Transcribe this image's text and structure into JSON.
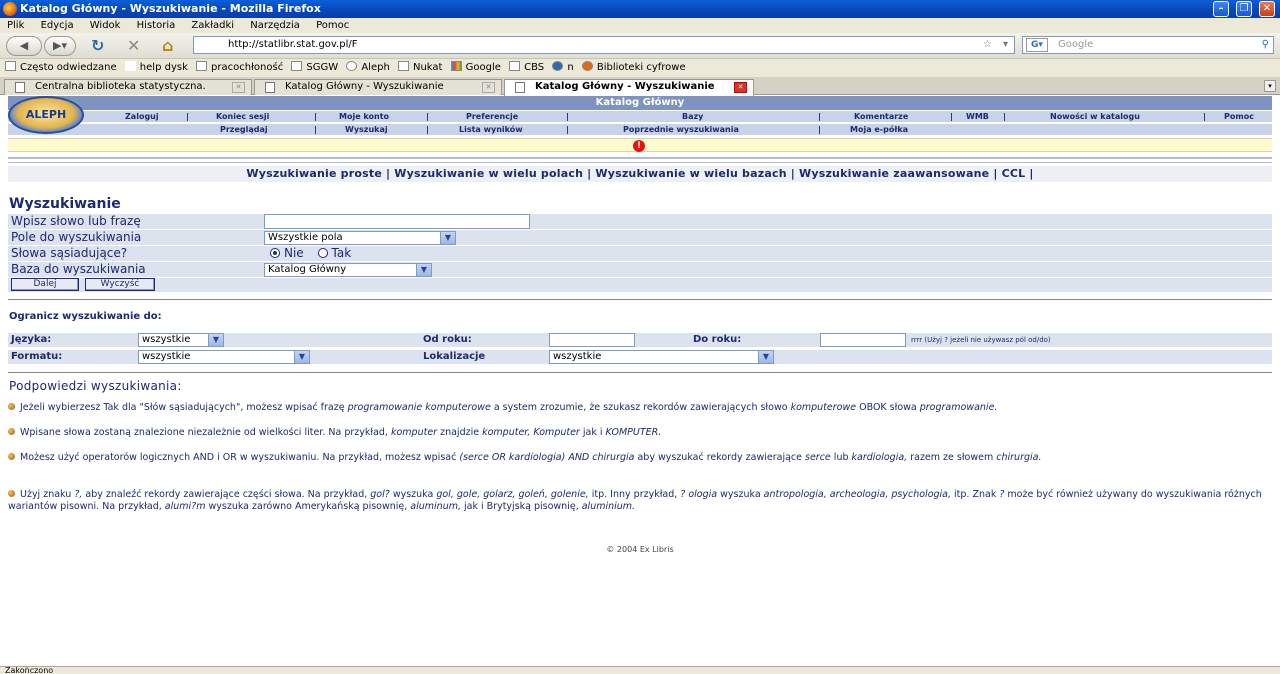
{
  "window": {
    "title": "Katalog Główny - Wyszukiwanie - Mozilla Firefox"
  },
  "menu": [
    "Plik",
    "Edycja",
    "Widok",
    "Historia",
    "Zakładki",
    "Narzędzia",
    "Pomoc"
  ],
  "address": {
    "url": "http://statlibr.stat.gov.pl/F",
    "search_placeholder": "Google"
  },
  "bookmarks": [
    "Często odwiedzane",
    "help dysk",
    "pracochłoność",
    "SGGW",
    "Aleph",
    "Nukat",
    "Google",
    "CBS",
    "n",
    "Biblioteki cyfrowe"
  ],
  "tabs": [
    {
      "label": "Centralna biblioteka statystyczna."
    },
    {
      "label": "Katalog Główny - Wyszukiwanie"
    },
    {
      "label": "Katalog Główny - Wyszukiwanie"
    }
  ],
  "aleph": {
    "logo": "ALEPH",
    "title": "Katalog Główny",
    "row1": [
      "Zaloguj",
      "Koniec sesji",
      "Moje konto",
      "Preferencje",
      "Bazy",
      "Komentarze",
      "WMB",
      "Nowości w katalogu",
      "Pomoc"
    ],
    "row2": [
      "Przeglądaj",
      "Wyszukaj",
      "Lista wyników",
      "Poprzednie wyszukiwania",
      "Moja e-półka"
    ],
    "warning_icon": "!"
  },
  "modes": "Wyszukiwanie proste | Wyszukiwanie w wielu polach | Wyszukiwanie w wielu bazach | Wyszukiwanie zaawansowane | CCL |",
  "search": {
    "heading": "Wyszukiwanie",
    "phrase_label": "Wpisz słowo lub frazę",
    "phrase_value": "",
    "field_label": "Pole do wyszukiwania",
    "field_value": "Wszystkie pola",
    "adjacent_label": "Słowa sąsiadujące?",
    "adjacent_no": "Nie",
    "adjacent_yes": "Tak",
    "base_label": "Baza do wyszukiwania",
    "base_value": "Katalog Główny",
    "submit": "Dalej",
    "clear": "Wyczyść"
  },
  "limits": {
    "heading": "Ogranicz wyszukiwanie do:",
    "language_label": "Języka:",
    "language_value": "wszystkie",
    "from_label": "Od roku:",
    "to_label": "Do roku:",
    "year_note": "rrrr (Użyj ? jeżeli nie używasz pól od/do)",
    "format_label": "Formatu:",
    "format_value": "wszystkie",
    "location_label": "Lokalizacje",
    "location_value": "wszystkie"
  },
  "hints": {
    "heading": "Podpowiedzi wyszukiwania:",
    "h1_a": "Jeżeli wybierzesz Tak dla \"Słów sąsiadujących\", możesz wpisać frazę ",
    "h1_b": "programowanie komputerowe",
    "h1_c": " a system zrozumie, że szukasz rekordów zawierających słowo ",
    "h1_d": "komputerowe",
    "h1_e": " OBOK słowa ",
    "h1_f": "programowanie.",
    "h2_a": "Wpisane słowa zostaną znalezione niezależnie od wielkości liter. Na przykład, ",
    "h2_b": "komputer",
    "h2_c": " znajdzie ",
    "h2_d": "komputer, Komputer",
    "h2_e": " jak i ",
    "h2_f": "KOMPUTER.",
    "h3_a": "Możesz użyć operatorów logicznych AND i OR w wyszukiwaniu. Na przykład, możesz wpisać ",
    "h3_b": "(serce OR kardiologia) AND chirurgia",
    "h3_c": " aby wyszukać rekordy zawierające ",
    "h3_d": "serce",
    "h3_e": " lub ",
    "h3_f": "kardiologia,",
    "h3_g": " razem ze słowem ",
    "h3_h": "chirurgia.",
    "h4_a": "Użyj znaku ",
    "h4_b": "?,",
    "h4_c": " aby znaleźć rekordy zawierające części słowa. Na przykład, ",
    "h4_d": "gol?",
    "h4_e": " wyszuka ",
    "h4_f": "gol, gole, golarz, goleń, golenie,",
    "h4_g": " itp. Inny przykład, ",
    "h4_h": "? ologia",
    "h4_i": " wyszuka ",
    "h4_j": "antropologia, archeologia, psychologia,",
    "h4_k": " itp. Znak ",
    "h4_l": "?",
    "h4_m": " może być również używany do wyszukiwania różnych wariantów pisowni. Na przykład, ",
    "h4_n": "alumi?m",
    "h4_o": " wyszuka zarówno Amerykańską pisownię, ",
    "h4_p": "aluminum,",
    "h4_q": " jak i Brytyjską pisownię, ",
    "h4_r": "aluminium."
  },
  "footer": "© 2004 Ex Libris",
  "status": "Zakończono"
}
